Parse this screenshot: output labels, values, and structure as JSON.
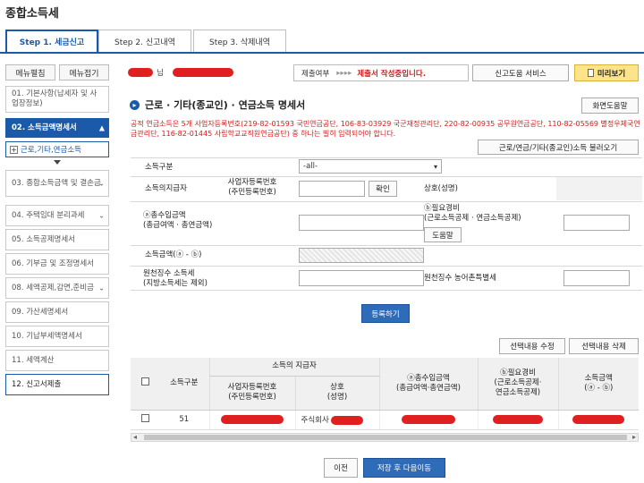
{
  "page_title": "종합소득세",
  "tabs": [
    {
      "label": "Step 1. 세금신고"
    },
    {
      "label": "Step 2. 신고내역"
    },
    {
      "label": "Step 3. 삭제내역"
    }
  ],
  "sidebar": {
    "expand_label": "메뉴펼침",
    "collapse_label": "메뉴접기",
    "items": [
      {
        "label": "01. 기본사항(납세자 및 사업장정보)"
      },
      {
        "label": "02. 소득금액명세서"
      },
      {
        "label": "03. 종합소득금액 및 결손금"
      },
      {
        "label": "04. 주택임대 분리과세"
      },
      {
        "label": "05. 소득공제명세서"
      },
      {
        "label": "06. 기부금 및 조정명세서"
      },
      {
        "label": "08. 세액공제,감면,준비금"
      },
      {
        "label": "09. 가산세명세서"
      },
      {
        "label": "10. 기납부세액명세서"
      },
      {
        "label": "11. 세액계산"
      },
      {
        "label": "12. 신고서제출"
      }
    ],
    "subitem": "근로,기타,연금소득"
  },
  "header": {
    "user_suffix": "님",
    "status_label": "제출여부",
    "status_arrows": "▸▸▸▸",
    "status_value": "제출서 작성중입니다.",
    "help_service": "신고도움 서비스",
    "preview": "미리보기",
    "screen_help": "화면도움말"
  },
  "section": {
    "title": "근로 · 기타(종교인) · 연금소득 명세서",
    "notice": "공적 연금소득은 5개 사업자등록번호(219-82-01593 국민연금공단, 106-83-03929 국군재정관리단, 220-82-00935 공무원연금공단, 110-82-05569 별정우체국연금관리단, 116-82-01445 사립학교교직원연금공단) 중 하나는 빌히 입력되어야 합니다.",
    "load_button": "근로/연금/기타(종교인)소득 불러오기"
  },
  "form": {
    "income_type_label": "소득구분",
    "income_type_value": "-all-",
    "payer_label": "소득의지급자",
    "biz_no_label": "사업자등록번호\n(주민등록번호)",
    "confirm_button": "확인",
    "trade_name_label": "상호(성명)",
    "total_income_label": "ⓐ총수입금액\n(총급여액 · 총연금액)",
    "expense_label": "ⓑ필요경비\n(근로소득공제 · 연금소득공제)",
    "help_button": "도움말",
    "income_amount_label": "소득금액(ⓐ - ⓑ)",
    "withholding_label": "원천징수 소득세\n(지방소득세는 제외)",
    "rural_tax_label": "원천징수 농어촌특별세",
    "register_button": "등록하기"
  },
  "actions": {
    "edit_selected": "선택내용 수정",
    "delete_selected": "선택내용 삭제"
  },
  "table": {
    "col_income_type": "소득구분",
    "col_payer_group": "소득의 지급자",
    "col_biz_no": "사업자등록번호\n(주민등록번호)",
    "col_trade_name": "상호\n(성명)",
    "col_total_income": "ⓐ총수입금액\n(총급여액·총연금액)",
    "col_expense": "ⓑ필요경비\n(근로소득공제·\n연금소득공제)",
    "col_income_amount": "소득금액\n(ⓐ - ⓑ)",
    "rows": [
      {
        "income_type": "51",
        "trade_name_prefix": "주식회사"
      }
    ]
  },
  "footer": {
    "prev_button": "이전",
    "save_next_button": "저장 후 다음이동"
  },
  "colors": {
    "accent": "#1a5aa8",
    "notice_red": "#d21b1b",
    "preview_yellow": "#fde48a"
  }
}
